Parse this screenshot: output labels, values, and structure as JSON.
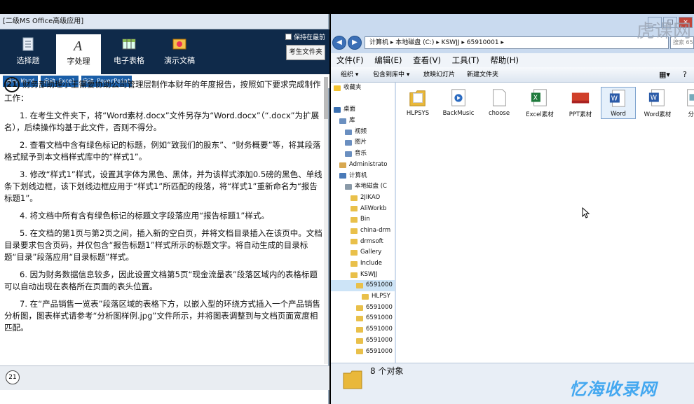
{
  "exam_window": {
    "title": "[二级MS Office高级应用]",
    "nav": [
      {
        "label": "选择题",
        "icon": "choice-icon"
      },
      {
        "label": "字处理",
        "icon": "word-process-icon"
      },
      {
        "label": "电子表格",
        "icon": "spreadsheet-icon"
      },
      {
        "label": "演示文稿",
        "icon": "presentation-icon"
      }
    ],
    "keep_top_label": "保持在最前",
    "student_folder_label": "考生文件夹",
    "launch_buttons": [
      "启动 Word",
      "启动 Excel",
      "启动 PowerPoint"
    ],
    "question_number": "21",
    "intro": "财务部助理小王需要协助公司管理层制作本财年的年度报告，按照如下要求完成制作工作：",
    "items": [
      "1. 在考生文件夹下，将“Word素材.docx”文件另存为“Word.docx”（“.docx”为扩展名），后续操作均基于此文件，否则不得分。",
      "2. 查看文档中含有绿色标记的标题，例如“致我们的股东”、“财务概要”等，将其段落格式赋予到本文档样式库中的“样式1”。",
      "3. 修改“样式1”样式，设置其字体为黑色、黑体，并为该样式添加0.5磅的黑色、单线条下划线边框，该下划线边框应用于“样式1”所匹配的段落，将“样式1”重新命名为“报告标题1”。",
      "4. 将文档中所有含有绿色标记的标题文字段落应用“报告标题1”样式。",
      "5. 在文档的第1页与第2页之间，插入新的空白页，并将文档目录插入在该页中。文档目录要求包含页码，并仅包含“报告标题1”样式所示的标题文字。将自动生成的目录标题“目录”段落应用“目录标题”样式。",
      "6. 因为财务数据信息较多，因此设置文档第5页“现金流量表”段落区域内的表格标题可以自动出现在表格所在页面的表头位置。",
      "7. 在“产品销售一览表”段落区域的表格下方，以嵌入型的环绕方式插入一个产品销售分析图，图表样式请参考“分析图样例.jpg”文件所示，并将图表调整到与文档页面宽度相匹配。"
    ],
    "bottom_number": "21"
  },
  "explorer": {
    "address": "计算机 ▸ 本地磁盘 (C:) ▸ KSWJJ ▸ 65910001 ▸",
    "search_placeholder": "搜索 65",
    "menu": [
      "文件(F)",
      "编辑(E)",
      "查看(V)",
      "工具(T)",
      "帮助(H)"
    ],
    "toolbar": [
      "组织 ▾",
      "包含到库中 ▾",
      "放映幻灯片",
      "新建文件夹"
    ],
    "tree": [
      {
        "label": "收藏夹",
        "indent": 0,
        "kind": "star"
      },
      {
        "label": "",
        "indent": 0,
        "kind": "blank"
      },
      {
        "label": "桌面",
        "indent": 0,
        "kind": "desktop"
      },
      {
        "label": "库",
        "indent": 1,
        "kind": "lib"
      },
      {
        "label": "视频",
        "indent": 2,
        "kind": "lib"
      },
      {
        "label": "图片",
        "indent": 2,
        "kind": "lib"
      },
      {
        "label": "音乐",
        "indent": 2,
        "kind": "lib"
      },
      {
        "label": "Administrato",
        "indent": 1,
        "kind": "user"
      },
      {
        "label": "计算机",
        "indent": 1,
        "kind": "pc"
      },
      {
        "label": "本地磁盘 (C",
        "indent": 2,
        "kind": "drive"
      },
      {
        "label": "2JIKAO",
        "indent": 3,
        "kind": "folder"
      },
      {
        "label": "AliWorkb",
        "indent": 3,
        "kind": "folder"
      },
      {
        "label": "Bin",
        "indent": 3,
        "kind": "folder"
      },
      {
        "label": "china-drm",
        "indent": 3,
        "kind": "folder"
      },
      {
        "label": "drmsoft",
        "indent": 3,
        "kind": "folder"
      },
      {
        "label": "Gallery",
        "indent": 3,
        "kind": "folder"
      },
      {
        "label": "Include",
        "indent": 3,
        "kind": "folder"
      },
      {
        "label": "KSWJJ",
        "indent": 3,
        "kind": "folder"
      },
      {
        "label": "6591000",
        "indent": 4,
        "kind": "folder",
        "selected": true
      },
      {
        "label": "HLPSY",
        "indent": 5,
        "kind": "folder"
      },
      {
        "label": "6591000",
        "indent": 4,
        "kind": "folder"
      },
      {
        "label": "6591000",
        "indent": 4,
        "kind": "folder"
      },
      {
        "label": "6591000",
        "indent": 4,
        "kind": "folder"
      },
      {
        "label": "6591000",
        "indent": 4,
        "kind": "folder"
      },
      {
        "label": "6591000",
        "indent": 4,
        "kind": "folder"
      }
    ],
    "files": [
      {
        "label": "HLPSYS",
        "icon": "folder-icon"
      },
      {
        "label": "BackMusic",
        "icon": "media-file-icon"
      },
      {
        "label": "choose",
        "icon": "blank-file-icon"
      },
      {
        "label": "Excel素材",
        "icon": "excel-file-icon"
      },
      {
        "label": "PPT素材",
        "icon": "ppt-file-icon"
      },
      {
        "label": "Word",
        "icon": "word-file-icon",
        "selected": true
      },
      {
        "label": "Word素材",
        "icon": "word-file-icon"
      },
      {
        "label": "分析",
        "icon": "image-file-icon"
      }
    ],
    "status_count": "8 个对象"
  },
  "overlay": {
    "bottom_watermark": "忆海收录网",
    "top_watermark": "虎课网"
  },
  "colors": {
    "nav_bg": "#0f2a4a",
    "launch_btn": "#1a5ea8",
    "explorer_chrome": "#c9daef",
    "watermark": "#44a8f0"
  }
}
